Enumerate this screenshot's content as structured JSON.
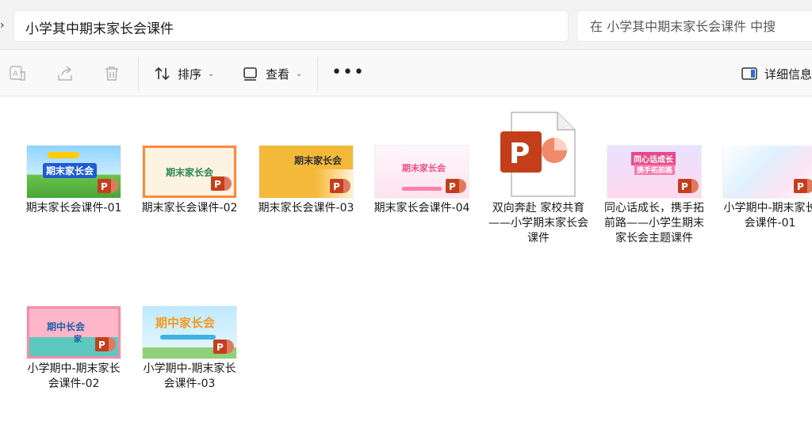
{
  "address": {
    "path": "小学其中期末家长会课件",
    "search_placeholder": "在 小学其中期末家长会课件 中搜"
  },
  "toolbar": {
    "sort_label": "排序",
    "view_label": "查看",
    "details_label": "详细信息"
  },
  "files": [
    {
      "name": "期末家长会课件-01",
      "thumb_text": "期末家长会"
    },
    {
      "name": "期末家长会课件-02",
      "thumb_text": "期末家长会"
    },
    {
      "name": "期末家长会课件-03",
      "thumb_text": "期末家长会"
    },
    {
      "name": "期末家长会课件-04",
      "thumb_text": "期末家长会"
    },
    {
      "name": "双向奔赴 家校共育——小学期末家长会课件"
    },
    {
      "name": "同心话成长，携手拓前路——小学生期末家长会主题课件",
      "thumb_text": "同心话成长",
      "thumb_text2": "携手拓前路"
    },
    {
      "name": "小学期中-期末家长会课件-01"
    },
    {
      "name": "小学期中-期末家长会课件-02",
      "thumb_text": "期中长会",
      "thumb_text2": "家"
    },
    {
      "name": "小学期中-期末家长会课件-03",
      "thumb_text": "期中家长会"
    }
  ],
  "colors": {
    "ppt_orange": "#d24726",
    "ppt_red": "#c43e1c"
  },
  "icons": [
    "translate-icon",
    "share-icon",
    "delete-icon",
    "sort-icon",
    "view-icon",
    "more-icon",
    "details-pane-icon",
    "powerpoint-icon"
  ]
}
